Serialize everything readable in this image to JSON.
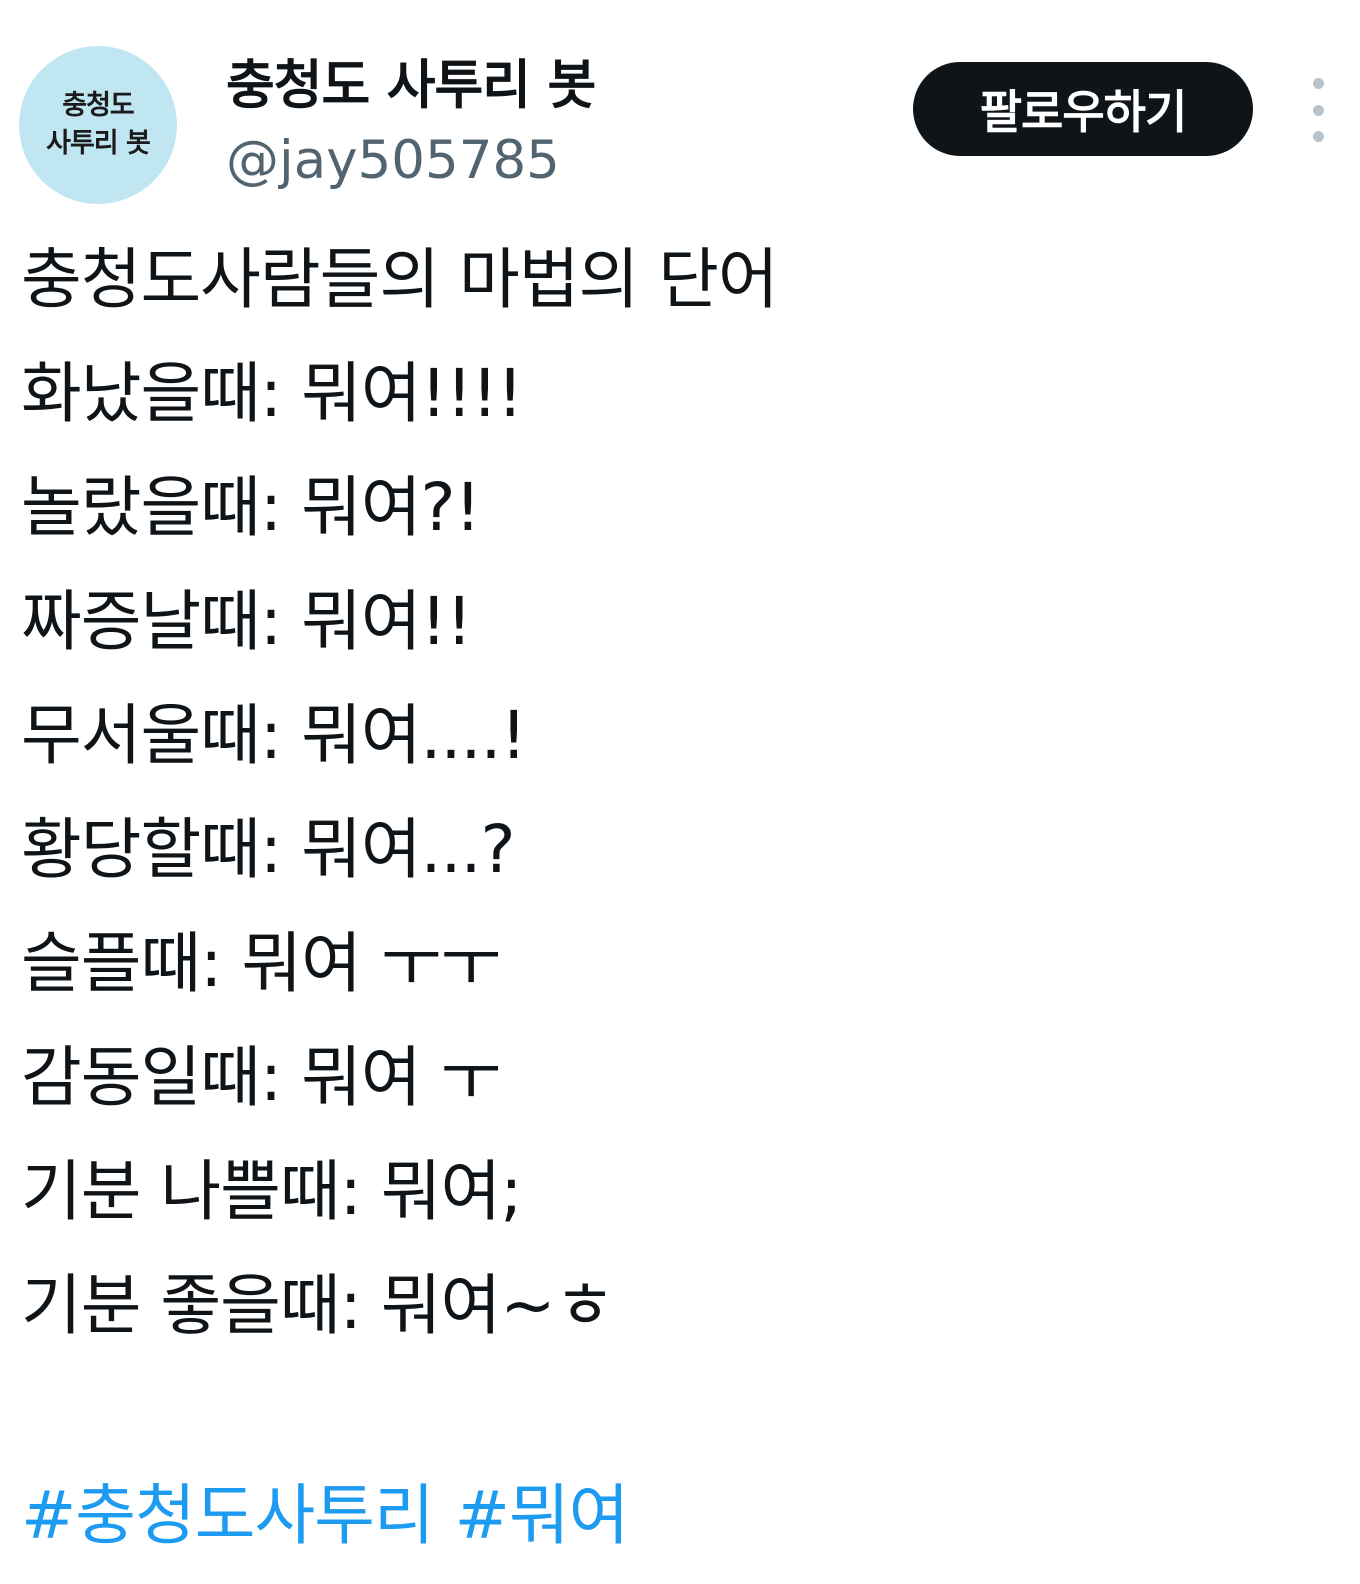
{
  "author": {
    "avatar_text": [
      "충청도",
      "사투리 봇"
    ],
    "display_name": "충청도 사투리 봇",
    "handle": "@jay505785"
  },
  "actions": {
    "follow_label": "팔로우하기",
    "more_icon": "more-vertical-icon"
  },
  "tweet": {
    "lines": [
      "충청도사람들의 마법의 단어",
      "화났을때: 뭐여!!!!",
      "놀랐을때: 뭐여?!",
      "짜증날때: 뭐여!!",
      "무서울때: 뭐여....!",
      "황당할때: 뭐여...?",
      "슬플때: 뭐여 ㅜㅜ",
      "감동일때: 뭐여 ㅜ",
      "기분 나쁠때: 뭐여;",
      "기분 좋을때: 뭐여~ㅎ"
    ],
    "hashtags": [
      "#충청도사투리",
      "#뭐여"
    ]
  },
  "colors": {
    "text": "#0f1419",
    "secondary": "#536471",
    "link": "#1d9bf0",
    "button_bg": "#0f1419",
    "avatar_bg": "#bfe6f1"
  }
}
